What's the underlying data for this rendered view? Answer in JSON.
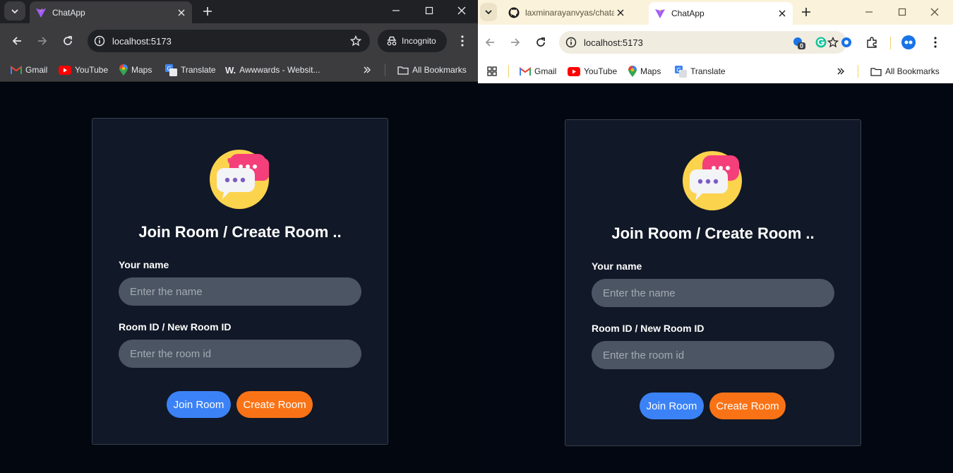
{
  "left_window": {
    "tab_title": "ChatApp",
    "address": "localhost:5173",
    "incognito_label": "Incognito",
    "bookmarks": [
      "Gmail",
      "YouTube",
      "Maps",
      "Translate",
      "Awwwards - Websit..."
    ],
    "all_bookmarks": "All Bookmarks"
  },
  "right_window": {
    "inactive_tab_title": "laxminarayanvyas/chatapp",
    "tab_title": "ChatApp",
    "address": "localhost:5173",
    "extension_badge": "0",
    "bookmarks": [
      "Gmail",
      "YouTube",
      "Maps",
      "Translate"
    ],
    "all_bookmarks": "All Bookmarks"
  },
  "form": {
    "heading": "Join Room / Create Room ..",
    "name_label": "Your name",
    "name_placeholder": "Enter the name",
    "name_value": "",
    "room_label": "Room ID / New Room ID",
    "room_placeholder": "Enter the room id",
    "room_value": "",
    "join_button": "Join Room",
    "create_button": "Create Room"
  },
  "icons": {
    "tab_favicon": "vite-logo-icon",
    "logo": "chat-bubbles-logo-icon"
  },
  "colors": {
    "page_bg": "#03070f",
    "card_bg": "#111827",
    "input_bg": "#4b5563",
    "join_button": "#3b82f6",
    "create_button": "#f97316",
    "logo_circle": "#fcd34d",
    "logo_bubble": "#f43f7a"
  }
}
